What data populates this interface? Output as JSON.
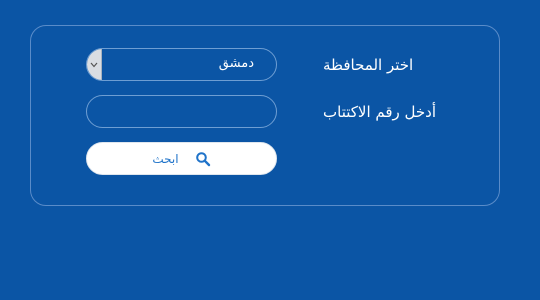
{
  "form": {
    "governorate_label": "اختر المحافظة",
    "governorate_value": "دمشق",
    "subscription_label": "أدخل رقم الاكتتاب",
    "subscription_value": "",
    "search_label": "ابحث"
  },
  "icons": {
    "search": "search-icon",
    "dropdown": "chevron-down-icon"
  },
  "colors": {
    "background": "#0b55a5",
    "button_text": "#1f73c9",
    "button_bg": "#ffffff"
  }
}
